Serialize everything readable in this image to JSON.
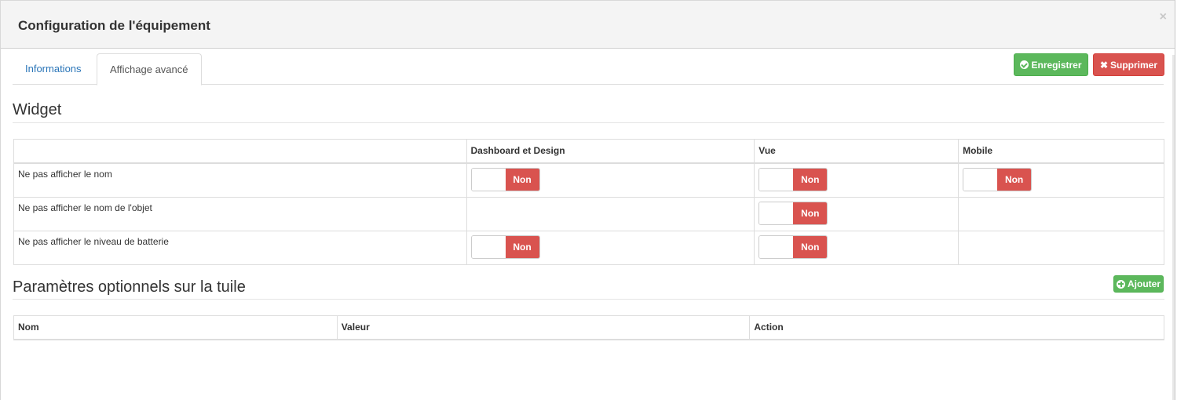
{
  "modal": {
    "title": "Configuration de l'équipement",
    "close_label": "×"
  },
  "tabs": [
    {
      "label": "Informations"
    },
    {
      "label": "Affichage avancé"
    }
  ],
  "toolbar": {
    "save_label": "Enregistrer",
    "delete_label": "Supprimer"
  },
  "widget": {
    "title": "Widget",
    "columns": [
      "",
      "Dashboard et Design",
      "Vue",
      "Mobile"
    ],
    "rows": [
      {
        "label": "Ne pas afficher le nom",
        "dashboard": "Non",
        "vue": "Non",
        "mobile": "Non"
      },
      {
        "label": "Ne pas afficher le nom de l'objet",
        "dashboard": null,
        "vue": "Non",
        "mobile": null
      },
      {
        "label": "Ne pas afficher le niveau de batterie",
        "dashboard": "Non",
        "vue": "Non",
        "mobile": null
      }
    ]
  },
  "params": {
    "title": "Paramètres optionnels sur la tuile",
    "add_label": "Ajouter",
    "columns": [
      "Nom",
      "Valeur",
      "Action"
    ]
  },
  "colors": {
    "success": "#5cb85c",
    "danger": "#d9534f",
    "link": "#2a75b8"
  }
}
